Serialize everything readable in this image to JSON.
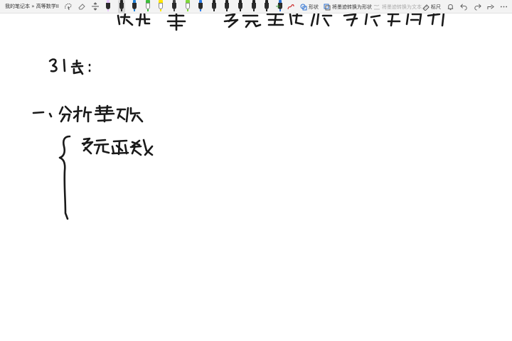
{
  "breadcrumb": {
    "text": "我的笔记本 » 高等数学II"
  },
  "toolbar": {
    "tools": [
      {
        "icon": "lasso-select-icon"
      },
      {
        "icon": "eraser-icon"
      },
      {
        "icon": "insert-space-icon"
      }
    ],
    "pens": [
      {
        "color": "#e8c8ff",
        "icon": "pen-icon"
      },
      {
        "color": "#222222",
        "icon": "pen-icon",
        "selected": true
      },
      {
        "color": "#1e7fd6",
        "icon": "pen-icon"
      },
      {
        "color": "#3dbd3a",
        "icon": "highlighter-icon"
      },
      {
        "color": "#ffe600",
        "icon": "highlighter-icon"
      },
      {
        "color": "#444444",
        "icon": "pen-icon"
      },
      {
        "color": "#7fd83a",
        "icon": "highlighter-icon"
      },
      {
        "color": "#2c7be5",
        "icon": "pen-icon"
      },
      {
        "color": "#222222",
        "icon": "pen-icon"
      },
      {
        "color": "#222222",
        "icon": "pen-icon"
      },
      {
        "color": "#222222",
        "icon": "pen-icon"
      },
      {
        "color": "#222222",
        "icon": "pen-icon"
      },
      {
        "color": "#222222",
        "icon": "pen-icon"
      },
      {
        "color": "#2a6fd1",
        "icon": "pen-icon"
      }
    ],
    "add_pen": "+",
    "shape_label": "形状",
    "ink_to_shape_label": "将墨迹转换为形状",
    "ink_to_text_label": "将墨迹转换为文本",
    "ruler_label": "标尺"
  },
  "accent": "#2a6fd1"
}
